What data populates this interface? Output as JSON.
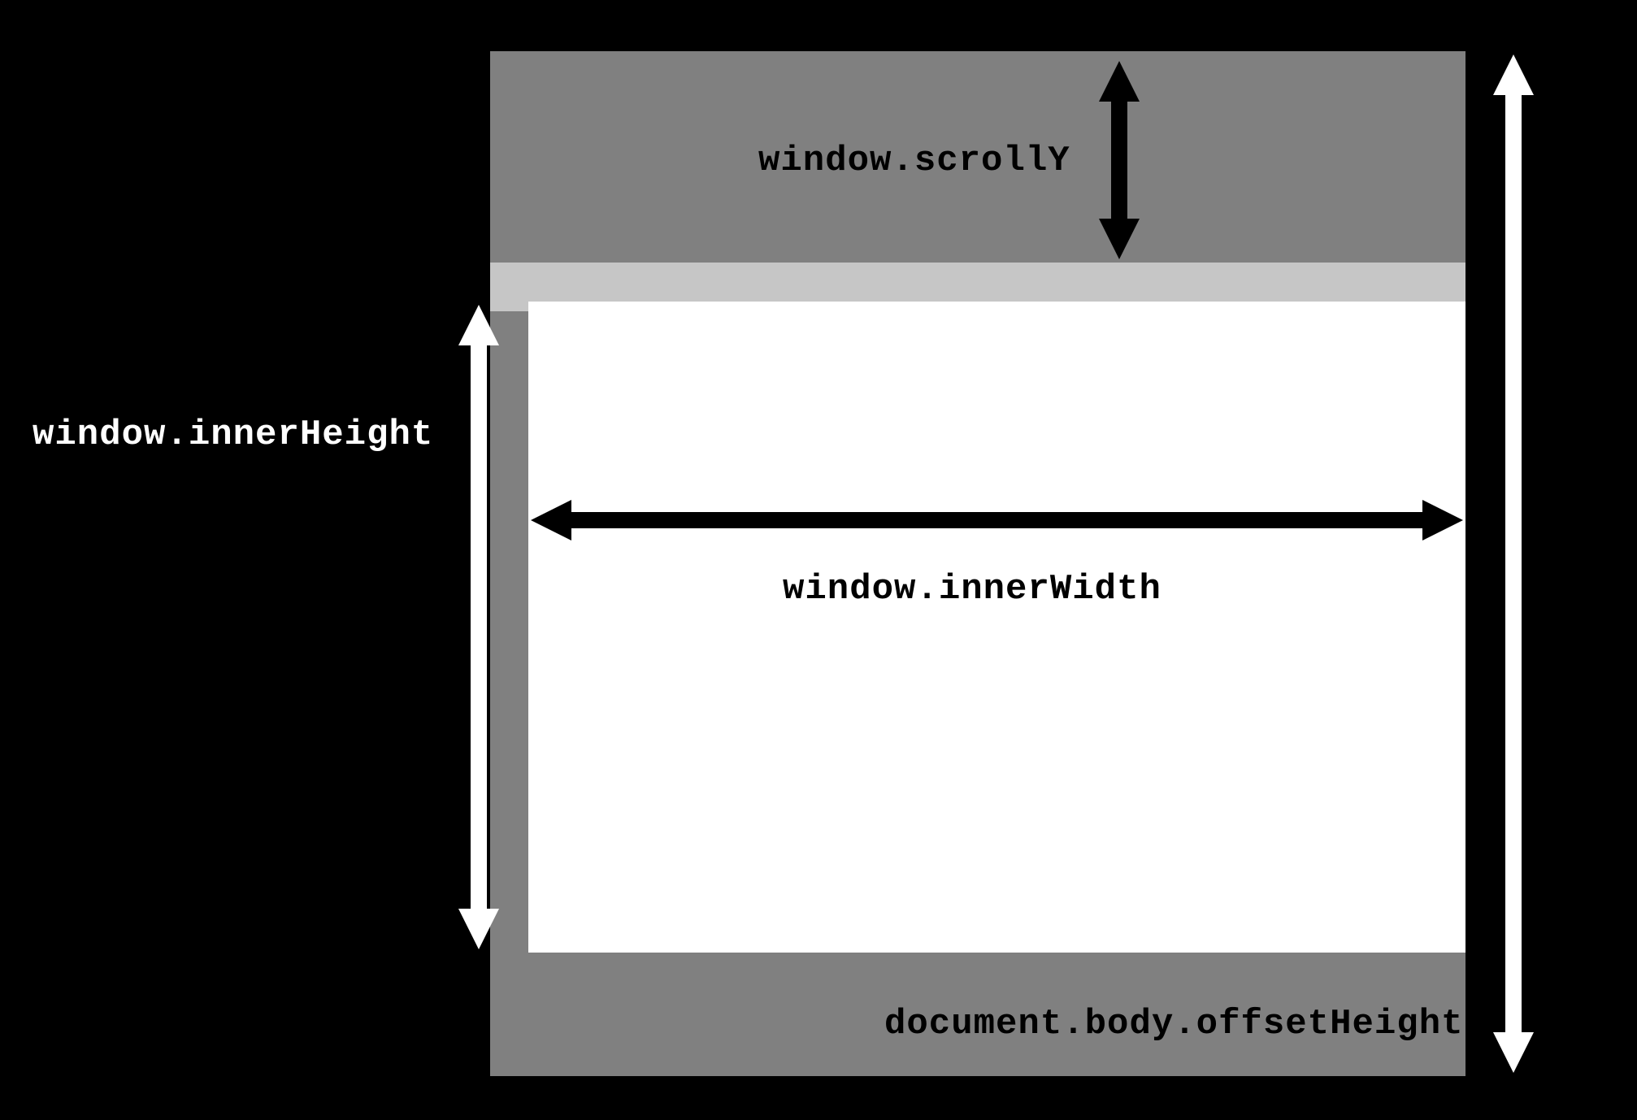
{
  "labels": {
    "innerHeight": "window.innerHeight",
    "scrollY": "window.scrollY",
    "innerWidth": "window.innerWidth",
    "offsetHeight": "document.body.offsetHeight"
  },
  "arrows": {
    "innerHeight": {
      "color": "#ffffff",
      "orientation": "vertical"
    },
    "scrollY": {
      "color": "#000000",
      "orientation": "vertical"
    },
    "innerWidth": {
      "color": "#000000",
      "orientation": "horizontal"
    },
    "offsetHeight": {
      "color": "#ffffff",
      "orientation": "vertical"
    }
  }
}
